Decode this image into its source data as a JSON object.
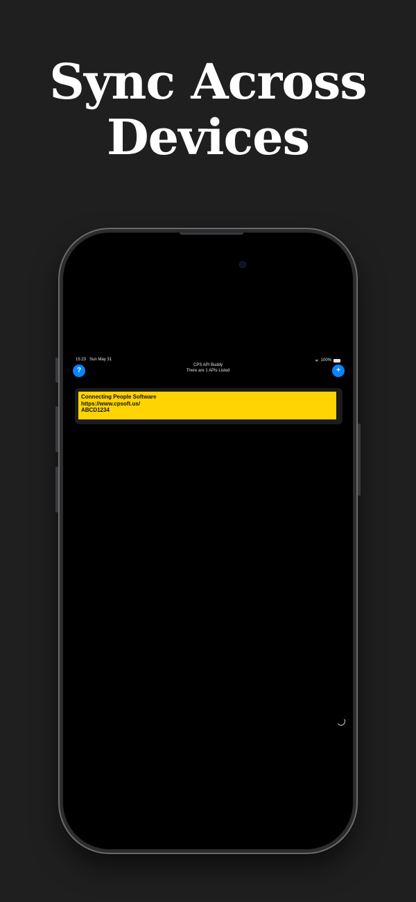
{
  "headline": {
    "line1": "Sync Across",
    "line2": "Devices"
  },
  "status_bar": {
    "time": "15:23",
    "date": "Sun May 31",
    "battery": "100%"
  },
  "nav": {
    "title": "CPS API Buddy",
    "subtitle": "There are 1 APIs Listed",
    "help_label": "?",
    "add_label": "+"
  },
  "api_list": [
    {
      "name": "Connecting People Software",
      "url": "https://www.cpsoft.us/",
      "key": "ABCD1234"
    }
  ],
  "colors": {
    "background": "#1f1f1f",
    "accent": "#0a84ff",
    "card": "#ffd400"
  }
}
